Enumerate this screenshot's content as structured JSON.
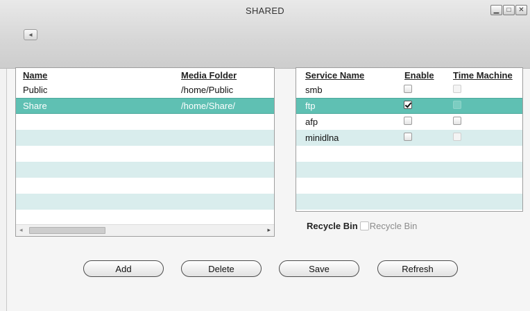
{
  "window": {
    "title": "SHARED",
    "controls": {
      "minimize": "▁",
      "maximize": "□",
      "close": "✕"
    },
    "back_icon": "◂"
  },
  "shares_table": {
    "columns": [
      "Name",
      "Media Folder"
    ],
    "rows": [
      {
        "name": "Public",
        "folder": "/home/Public"
      },
      {
        "name": "Share",
        "folder": "/home/Share/",
        "selected": true
      }
    ],
    "scroll_left": "◂",
    "scroll_right": "▸"
  },
  "services_table": {
    "columns": [
      "Service Name",
      "Enable",
      "Time Machine"
    ],
    "rows": [
      {
        "service": "smb",
        "enable": false,
        "time_machine": "disabled"
      },
      {
        "service": "ftp",
        "enable": true,
        "time_machine": "disabled",
        "selected": true
      },
      {
        "service": "afp",
        "enable": false,
        "time_machine": "unchecked"
      },
      {
        "service": "minidlna",
        "enable": false,
        "time_machine": "disabled"
      }
    ]
  },
  "recycle_bin": {
    "label": "Recycle Bin",
    "checkbox_label": "Recycle Bin",
    "checked": false
  },
  "buttons": {
    "add": "Add",
    "delete": "Delete",
    "save": "Save",
    "refresh": "Refresh"
  },
  "colors": {
    "selected_row": "#5fc0b3",
    "alt_row": "#d9eded"
  }
}
